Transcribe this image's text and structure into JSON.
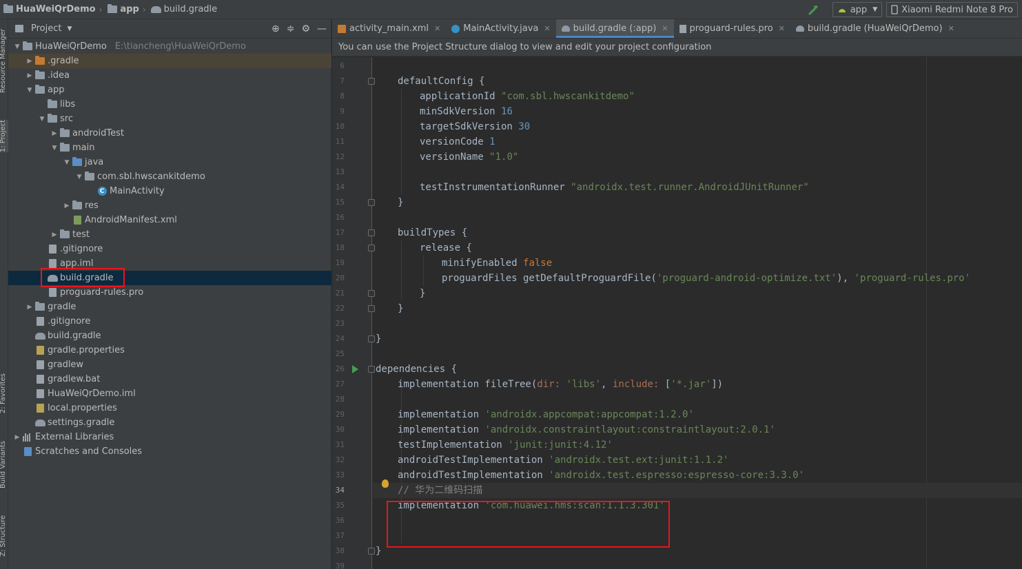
{
  "navbar": {
    "project": "HuaWeiQrDemo",
    "module": "app",
    "file": "build.gradle",
    "run_config": "app",
    "device": "Xiaomi Redmi Note 8 Pro"
  },
  "left_stripe": {
    "resource_manager": "Resource Manager",
    "project": "1: Project",
    "favorites": "2: Favorites",
    "build_variants": "Build Variants",
    "structure": "Z: Structure"
  },
  "project_panel": {
    "title": "Project",
    "tree": [
      {
        "label": "HuaWeiQrDemo",
        "hint": "E:\\tiancheng\\HuaWeiQrDemo",
        "depth": 0,
        "arrow": "down",
        "icon": "folder-module-icon"
      },
      {
        "label": ".gradle",
        "depth": 1,
        "arrow": "right",
        "icon": "folder-orange-icon"
      },
      {
        "label": ".idea",
        "depth": 1,
        "arrow": "right",
        "icon": "folder-icon"
      },
      {
        "label": "app",
        "depth": 1,
        "arrow": "down",
        "icon": "folder-module-icon"
      },
      {
        "label": "libs",
        "depth": 2,
        "arrow": "",
        "icon": "folder-icon"
      },
      {
        "label": "src",
        "depth": 2,
        "arrow": "down",
        "icon": "folder-icon"
      },
      {
        "label": "androidTest",
        "depth": 3,
        "arrow": "right",
        "icon": "folder-icon"
      },
      {
        "label": "main",
        "depth": 3,
        "arrow": "down",
        "icon": "folder-icon"
      },
      {
        "label": "java",
        "depth": 4,
        "arrow": "down",
        "icon": "folder-blue-icon"
      },
      {
        "label": "com.sbl.hwscankitdemo",
        "depth": 5,
        "arrow": "down",
        "icon": "package-icon"
      },
      {
        "label": "MainActivity",
        "depth": 6,
        "arrow": "",
        "icon": "class-icon"
      },
      {
        "label": "res",
        "depth": 4,
        "arrow": "right",
        "icon": "folder-res-icon"
      },
      {
        "label": "AndroidManifest.xml",
        "depth": 4,
        "arrow": "",
        "icon": "manifest-icon"
      },
      {
        "label": "test",
        "depth": 3,
        "arrow": "right",
        "icon": "folder-icon"
      },
      {
        "label": ".gitignore",
        "depth": 2,
        "arrow": "",
        "icon": "gitignore-icon"
      },
      {
        "label": "app.iml",
        "depth": 2,
        "arrow": "",
        "icon": "iml-icon"
      },
      {
        "label": "build.gradle",
        "depth": 2,
        "arrow": "",
        "icon": "gradle-icon"
      },
      {
        "label": "proguard-rules.pro",
        "depth": 2,
        "arrow": "",
        "icon": "file-icon"
      },
      {
        "label": "gradle",
        "depth": 1,
        "arrow": "right",
        "icon": "folder-icon"
      },
      {
        "label": ".gitignore",
        "depth": 1,
        "arrow": "",
        "icon": "gitignore-icon"
      },
      {
        "label": "build.gradle",
        "depth": 1,
        "arrow": "",
        "icon": "gradle-icon"
      },
      {
        "label": "gradle.properties",
        "depth": 1,
        "arrow": "",
        "icon": "properties-icon"
      },
      {
        "label": "gradlew",
        "depth": 1,
        "arrow": "",
        "icon": "file-icon"
      },
      {
        "label": "gradlew.bat",
        "depth": 1,
        "arrow": "",
        "icon": "file-icon"
      },
      {
        "label": "HuaWeiQrDemo.iml",
        "depth": 1,
        "arrow": "",
        "icon": "iml-icon"
      },
      {
        "label": "local.properties",
        "depth": 1,
        "arrow": "",
        "icon": "properties-icon"
      },
      {
        "label": "settings.gradle",
        "depth": 1,
        "arrow": "",
        "icon": "gradle-icon"
      },
      {
        "label": "External Libraries",
        "depth": 0,
        "arrow": "right",
        "icon": "libraries-icon"
      },
      {
        "label": "Scratches and Consoles",
        "depth": 0,
        "arrow": "",
        "icon": "scratches-icon"
      }
    ]
  },
  "editor": {
    "tabs": [
      {
        "label": "activity_main.xml",
        "icon": "xml-icon"
      },
      {
        "label": "MainActivity.java",
        "icon": "class-icon"
      },
      {
        "label": "build.gradle (:app)",
        "icon": "gradle-icon"
      },
      {
        "label": "proguard-rules.pro",
        "icon": "file-icon"
      },
      {
        "label": "build.gradle (HuaWeiQrDemo)",
        "icon": "gradle-icon"
      }
    ],
    "banner": "You can use the Project Structure dialog to view and edit your project configuration",
    "lines": [
      {
        "n": "6",
        "indent": 0,
        "tokens": []
      },
      {
        "n": "7",
        "indent": 1,
        "tokens": [
          [
            "t",
            "defaultConfig {"
          ]
        ]
      },
      {
        "n": "8",
        "indent": 2,
        "tokens": [
          [
            "t",
            "applicationId "
          ],
          [
            "s",
            "\"com.sbl.hwscankitdemo\""
          ]
        ]
      },
      {
        "n": "9",
        "indent": 2,
        "tokens": [
          [
            "t",
            "minSdkVersion "
          ],
          [
            "n",
            "16"
          ]
        ]
      },
      {
        "n": "10",
        "indent": 2,
        "tokens": [
          [
            "t",
            "targetSdkVersion "
          ],
          [
            "n",
            "30"
          ]
        ]
      },
      {
        "n": "11",
        "indent": 2,
        "tokens": [
          [
            "t",
            "versionCode "
          ],
          [
            "n",
            "1"
          ]
        ]
      },
      {
        "n": "12",
        "indent": 2,
        "tokens": [
          [
            "t",
            "versionName "
          ],
          [
            "s",
            "\"1.0\""
          ]
        ]
      },
      {
        "n": "13",
        "indent": 0,
        "tokens": []
      },
      {
        "n": "14",
        "indent": 2,
        "tokens": [
          [
            "t",
            "testInstrumentationRunner "
          ],
          [
            "s",
            "\"androidx.test.runner.AndroidJUnitRunner\""
          ]
        ]
      },
      {
        "n": "15",
        "indent": 1,
        "tokens": [
          [
            "t",
            "}"
          ]
        ]
      },
      {
        "n": "16",
        "indent": 0,
        "tokens": []
      },
      {
        "n": "17",
        "indent": 1,
        "tokens": [
          [
            "t",
            "buildTypes {"
          ]
        ]
      },
      {
        "n": "18",
        "indent": 2,
        "tokens": [
          [
            "t",
            "release {"
          ]
        ]
      },
      {
        "n": "19",
        "indent": 3,
        "tokens": [
          [
            "t",
            "minifyEnabled "
          ],
          [
            "k",
            "false"
          ]
        ]
      },
      {
        "n": "20",
        "indent": 3,
        "tokens": [
          [
            "t",
            "proguardFiles getDefaultProguardFile("
          ],
          [
            "s",
            "'proguard-android-optimize.txt'"
          ],
          [
            "t",
            "), "
          ],
          [
            "s",
            "'proguard-rules.pro'"
          ]
        ]
      },
      {
        "n": "21",
        "indent": 2,
        "tokens": [
          [
            "t",
            "}"
          ]
        ]
      },
      {
        "n": "22",
        "indent": 1,
        "tokens": [
          [
            "t",
            "}"
          ]
        ]
      },
      {
        "n": "23",
        "indent": 0,
        "tokens": []
      },
      {
        "n": "24",
        "indent": 0,
        "tokens": [
          [
            "t",
            "}"
          ]
        ]
      },
      {
        "n": "25",
        "indent": 0,
        "tokens": []
      },
      {
        "n": "26",
        "indent": 0,
        "tokens": [
          [
            "t",
            "dependencies {"
          ]
        ]
      },
      {
        "n": "27",
        "indent": 1,
        "tokens": [
          [
            "t",
            "implementation fileTree("
          ],
          [
            "p",
            "dir: "
          ],
          [
            "s",
            "'libs'"
          ],
          [
            "t",
            ", "
          ],
          [
            "p",
            "include: "
          ],
          [
            "t",
            "["
          ],
          [
            "s",
            "'*.jar'"
          ],
          [
            "t",
            "])"
          ]
        ]
      },
      {
        "n": "28",
        "indent": 0,
        "tokens": []
      },
      {
        "n": "29",
        "indent": 1,
        "tokens": [
          [
            "t",
            "implementation "
          ],
          [
            "s",
            "'androidx.appcompat:appcompat:1.2.0'"
          ]
        ]
      },
      {
        "n": "30",
        "indent": 1,
        "tokens": [
          [
            "t",
            "implementation "
          ],
          [
            "s",
            "'androidx.constraintlayout:constraintlayout:2.0.1'"
          ]
        ]
      },
      {
        "n": "31",
        "indent": 1,
        "tokens": [
          [
            "t",
            "testImplementation "
          ],
          [
            "s",
            "'junit:junit:4.12'"
          ]
        ]
      },
      {
        "n": "32",
        "indent": 1,
        "tokens": [
          [
            "t",
            "androidTestImplementation "
          ],
          [
            "s",
            "'androidx.test.ext:junit:1.1.2'"
          ]
        ]
      },
      {
        "n": "33",
        "indent": 1,
        "tokens": [
          [
            "t",
            "androidTestImplementation "
          ],
          [
            "s",
            "'androidx.test.espresso:espresso-core:3.3.0'"
          ]
        ]
      },
      {
        "n": "34",
        "indent": 1,
        "tokens": [
          [
            "c",
            "// 华为二维码扫描"
          ]
        ]
      },
      {
        "n": "35",
        "indent": 1,
        "tokens": [
          [
            "t",
            "implementation "
          ],
          [
            "s",
            "'com.huawei.hms:scan:1.1.3.301'"
          ]
        ]
      },
      {
        "n": "36",
        "indent": 0,
        "tokens": []
      },
      {
        "n": "37",
        "indent": 0,
        "tokens": []
      },
      {
        "n": "38",
        "indent": 0,
        "tokens": [
          [
            "t",
            "}"
          ]
        ]
      },
      {
        "n": "39",
        "indent": 0,
        "tokens": []
      }
    ]
  }
}
